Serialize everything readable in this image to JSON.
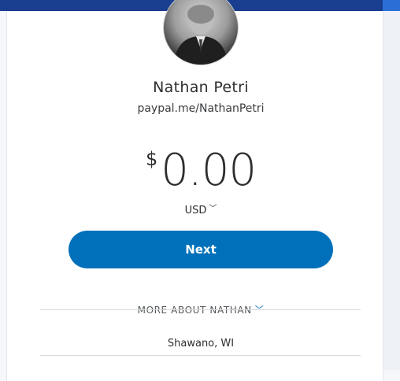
{
  "profile": {
    "name": "Nathan Petri",
    "handle": "paypal.me/NathanPetri",
    "avatar_icon": "profile-photo"
  },
  "payment": {
    "currency_symbol": "$",
    "amount": "0.00",
    "currency_code": "USD",
    "currency_chevron_icon": "chevron-down-icon"
  },
  "actions": {
    "next_label": "Next"
  },
  "about": {
    "toggle_label": "MORE ABOUT NATHAN",
    "toggle_icon": "chevron-down-icon",
    "location": "Shawano, WI"
  },
  "colors": {
    "brand_blue": "#0070ba",
    "topbar": "#1a3e8f"
  }
}
